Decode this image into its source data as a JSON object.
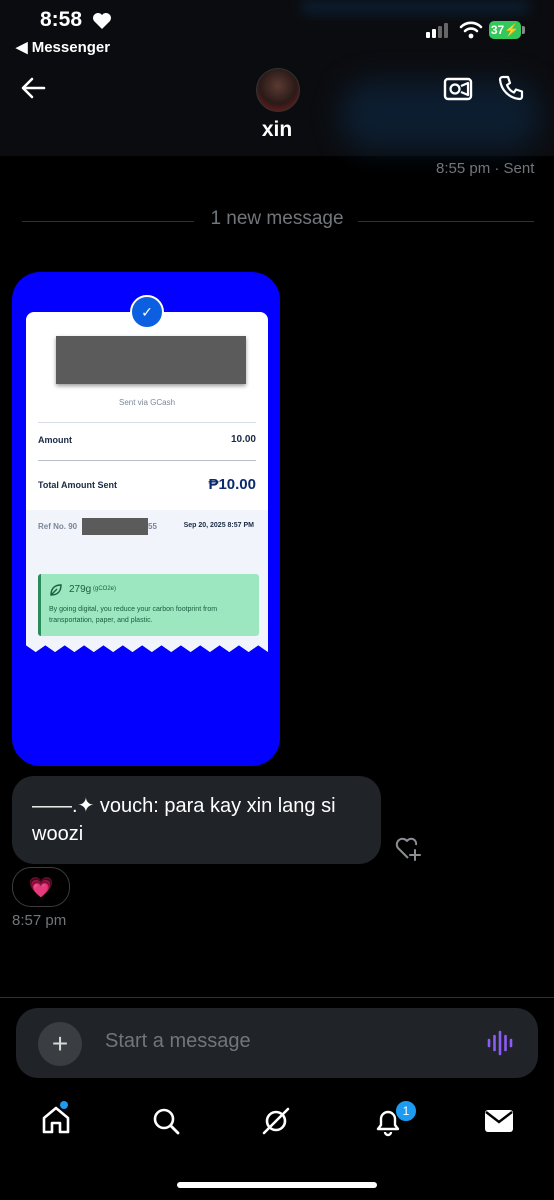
{
  "status_bar": {
    "time": "8:58",
    "back_app": "◀ Messenger",
    "battery": "37"
  },
  "header": {
    "contact_name": "xin"
  },
  "thread": {
    "sent_meta": "8:55 pm · Sent",
    "new_message_divider": "1 new message",
    "receipt": {
      "sent_via": "Sent via GCash",
      "amount_label": "Amount",
      "amount_value": "10.00",
      "total_label": "Total Amount Sent",
      "total_value": "₱10.00",
      "ref_prefix": "Ref No. 90",
      "ref_suffix": "55",
      "date": "Sep 20, 2025 8:57 PM",
      "carbon_value": "279g",
      "carbon_unit": "(gCO2e)",
      "carbon_text": "By going digital, you reduce your carbon footprint from transportation, paper, and plastic."
    },
    "text_message": "——.✦ vouch: para kay xin lang si woozi",
    "reaction": "💗",
    "message_time": "8:57 pm"
  },
  "composer": {
    "placeholder": "Start a message"
  },
  "tabbar": {
    "notifications_badge": "1"
  },
  "icons": [
    "back-arrow-icon",
    "video-call-icon",
    "phone-icon",
    "plus-icon",
    "voice-icon",
    "home-icon",
    "search-icon",
    "grok-icon",
    "bell-icon",
    "mail-icon",
    "heart-plus-icon"
  ]
}
